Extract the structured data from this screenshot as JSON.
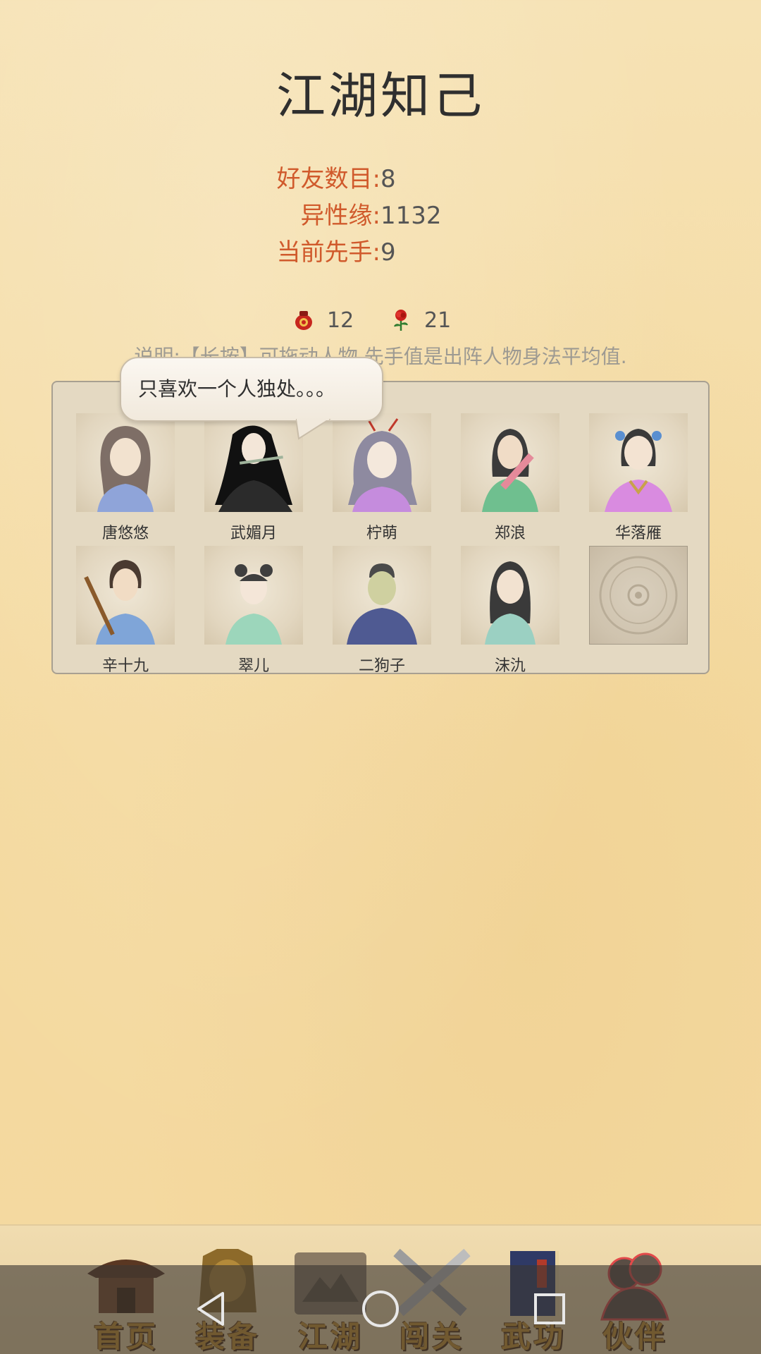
{
  "title": "江湖知己",
  "stats": [
    {
      "label": "好友数目",
      "value": "8"
    },
    {
      "label": "异性缘",
      "value": "1132"
    },
    {
      "label": "当前先手",
      "value": "9"
    }
  ],
  "resources": [
    {
      "icon": "wine-jar-icon",
      "value": "12"
    },
    {
      "icon": "rose-icon",
      "value": "21"
    }
  ],
  "description": "说明:【长按】可拖动人物.先手值是出阵人物身法平均值.",
  "speech_bubble": "只喜欢一个人独处。。。",
  "characters": [
    {
      "name": "唐悠悠",
      "hair": "#6b5a55",
      "robe": "#8fa4d9",
      "skin": "#f2e2cf"
    },
    {
      "name": "武媚月",
      "hair": "#111111",
      "robe": "#2b2b2b",
      "skin": "#f3e6d8"
    },
    {
      "name": "柠萌",
      "hair": "#8e8aa0",
      "robe": "#c58cdd",
      "skin": "#f4e8dc"
    },
    {
      "name": "郑浪",
      "hair": "#3b3b3b",
      "robe": "#6fbf8f",
      "skin": "#f0dcc6"
    },
    {
      "name": "华落雁",
      "hair": "#3a3a3a",
      "robe": "#d98be0",
      "skin": "#f3e3d2"
    },
    {
      "name": "辛十九",
      "hair": "#4a3a30",
      "robe": "#7fa5d8",
      "skin": "#f1dcc4"
    },
    {
      "name": "翠儿",
      "hair": "#3f3f3f",
      "robe": "#9cd6bb",
      "skin": "#f4e6d8"
    },
    {
      "name": "二狗子",
      "hair": "#4a4a4a",
      "robe": "#4f5a92",
      "skin": "#cfd0a0"
    },
    {
      "name": "沫氿",
      "hair": "#3a3a3a",
      "robe": "#9bd0c2",
      "skin": "#f2e2d0"
    }
  ],
  "nav": [
    {
      "label": "首页",
      "icon": "house-icon"
    },
    {
      "label": "装备",
      "icon": "armor-icon"
    },
    {
      "label": "江湖",
      "icon": "map-scroll-icon"
    },
    {
      "label": "闯关",
      "icon": "crossed-swords-icon"
    },
    {
      "label": "武功",
      "icon": "book-icon"
    },
    {
      "label": "伙伴",
      "icon": "companions-icon"
    }
  ],
  "colors": {
    "accent_label": "#d05a2c",
    "nav_text": "#c9912d",
    "nav_active_glow": "#e24a4a"
  }
}
